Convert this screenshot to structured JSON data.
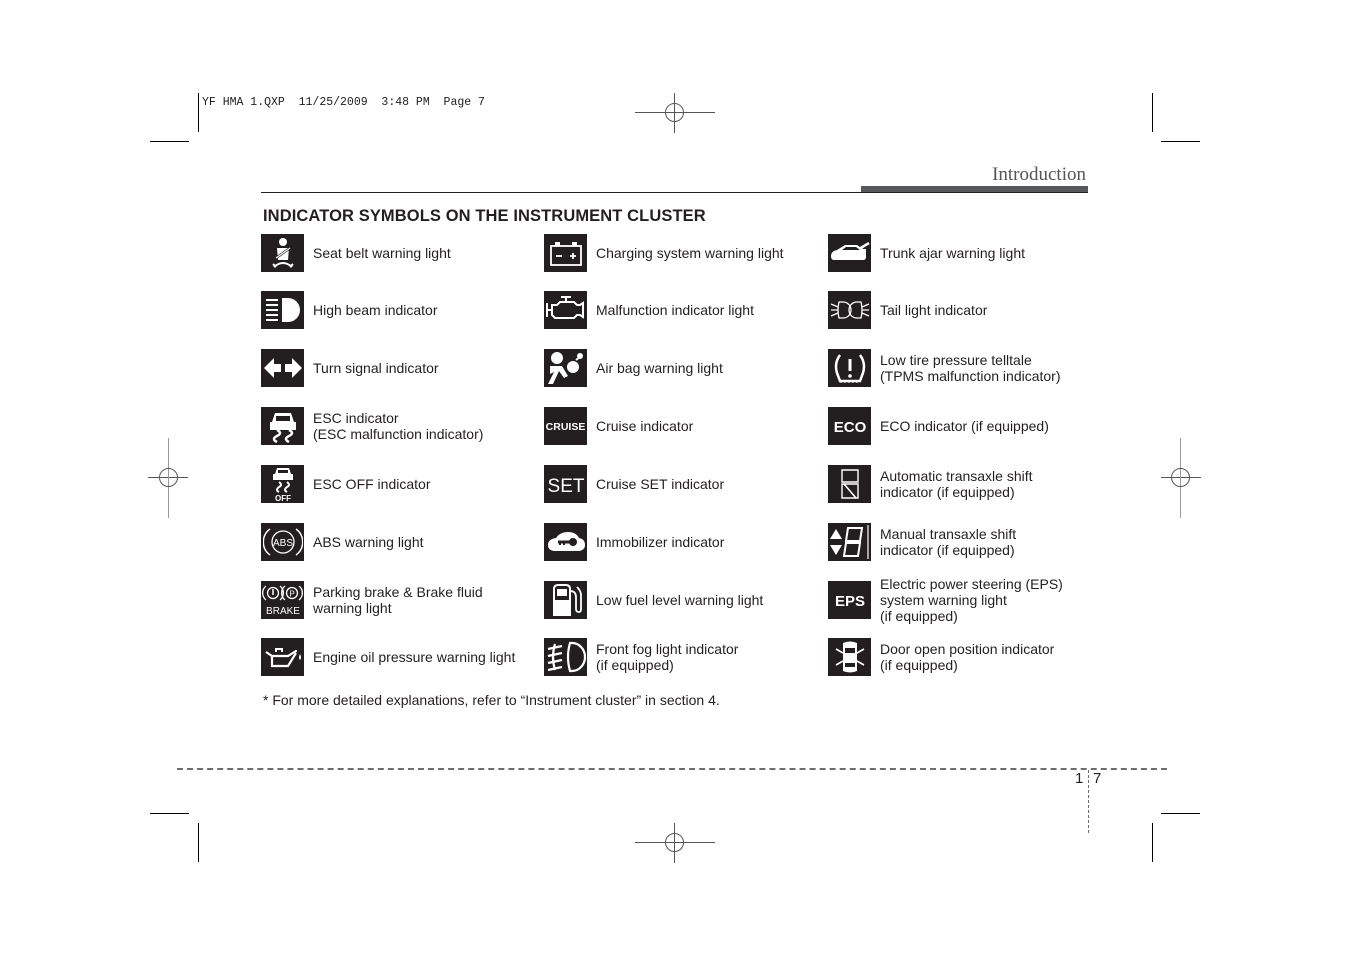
{
  "slug": "YF HMA 1.QXP  11/25/2009  3:48 PM  Page 7",
  "section_title": "Introduction",
  "heading": "INDICATOR SYMBOLS ON THE INSTRUMENT CLUSTER",
  "columns": [
    {
      "items": [
        {
          "icon": "seat-belt-icon",
          "label": "Seat belt warning light"
        },
        {
          "icon": "high-beam-icon",
          "label": "High beam indicator"
        },
        {
          "icon": "turn-signal-icon",
          "label": "Turn signal indicator"
        },
        {
          "icon": "esc-icon",
          "label": "ESC indicator\n(ESC malfunction indicator)"
        },
        {
          "icon": "esc-off-icon",
          "icon_text": "OFF",
          "label": "ESC OFF indicator"
        },
        {
          "icon": "abs-icon",
          "icon_text": "ABS",
          "label": "ABS warning light"
        },
        {
          "icon": "brake-icon",
          "icon_text": "BRAKE",
          "label": "Parking brake & Brake fluid\nwarning light"
        },
        {
          "icon": "oil-can-icon",
          "label": "Engine oil pressure warning light"
        }
      ]
    },
    {
      "items": [
        {
          "icon": "battery-icon",
          "label": "Charging system warning light"
        },
        {
          "icon": "engine-icon",
          "label": "Malfunction indicator light"
        },
        {
          "icon": "airbag-icon",
          "label": "Air bag warning light"
        },
        {
          "icon": "cruise-icon",
          "icon_text": "CRUISE",
          "label": "Cruise indicator"
        },
        {
          "icon": "set-icon",
          "icon_text": "SET",
          "label": "Cruise SET indicator"
        },
        {
          "icon": "immobilizer-icon",
          "label": "Immobilizer indicator"
        },
        {
          "icon": "fuel-pump-icon",
          "label": "Low fuel level warning light"
        },
        {
          "icon": "front-fog-icon",
          "label": "Front fog light indicator\n(if equipped)"
        }
      ]
    },
    {
      "items": [
        {
          "icon": "trunk-open-icon",
          "label": "Trunk ajar warning light"
        },
        {
          "icon": "tail-light-icon",
          "label": "Tail light indicator"
        },
        {
          "icon": "tire-pressure-icon",
          "label": "Low tire pressure telltale\n(TPMS malfunction indicator)"
        },
        {
          "icon": "eco-icon",
          "icon_text": "ECO",
          "label": "ECO indicator (if equipped)"
        },
        {
          "icon": "auto-shift-icon",
          "label": "Automatic transaxle shift\nindicator (if equipped)"
        },
        {
          "icon": "manual-shift-icon",
          "label": "Manual transaxle shift\nindicator (if equipped)"
        },
        {
          "icon": "eps-icon",
          "icon_text": "EPS",
          "label": "Electric power steering (EPS)\nsystem warning light\n(if equipped)"
        },
        {
          "icon": "door-open-icon",
          "label": "Door open position indicator\n (if equipped)"
        }
      ]
    }
  ],
  "footnote": "* For more detailed explanations, refer to “Instrument cluster” in section 4.",
  "page_number": {
    "section": "1",
    "page": "7"
  }
}
